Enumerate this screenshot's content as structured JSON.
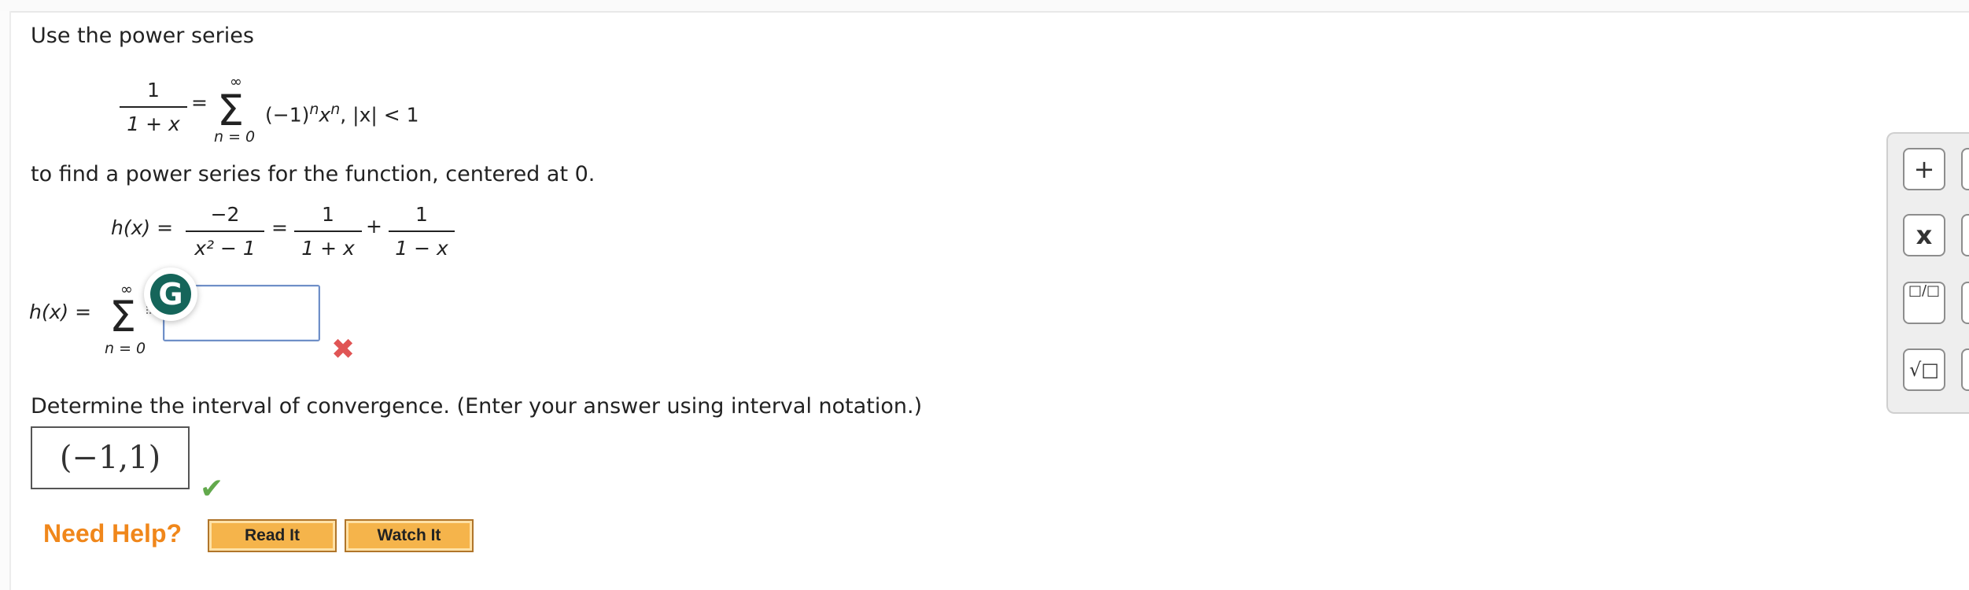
{
  "question": {
    "intro": "Use the power series",
    "given_series": {
      "frac_num": "1",
      "frac_den": "1 + x",
      "equals": "=",
      "sum_upper": "∞",
      "sum_lower": "n = 0",
      "term": "(−1)",
      "term_exp": "n",
      "term_x": "x",
      "term_x_exp": "n",
      "condition": ", |x| < 1"
    },
    "instruction": "to find a power series for the function, centered at 0.",
    "function": {
      "lhs": "h(x) =",
      "num1": "−2",
      "den1": "x² − 1",
      "equals": "=",
      "num2": "1",
      "den2": "1 + x",
      "plus": "+",
      "num3": "1",
      "den3": "1 − x"
    },
    "answer_series": {
      "lhs": "h(x) =",
      "sum_upper": "∞",
      "sum_lower": "n = 0",
      "input_value": ""
    },
    "feedback_incorrect_icon": "x-mark-icon",
    "interval_prompt": "Determine the interval of convergence. (Enter your answer using interval notation.)",
    "interval_answer": "(−1,1)",
    "feedback_correct_icon": "check-icon"
  },
  "help": {
    "label": "Need Help?",
    "read_it": "Read It",
    "watch_it": "Watch It"
  },
  "grammarly": {
    "icon": "grammarly-g-icon",
    "letter": "G"
  },
  "palette": {
    "buttons": [
      "+",
      "x",
      "□/□",
      "√□"
    ]
  },
  "colors": {
    "help_orange": "#f0871b",
    "button_fill": "#f5b44b",
    "incorrect_red": "#e05555",
    "correct_green": "#62a94c",
    "input_border": "#6f8fc7",
    "grammarly_green": "#15655a"
  }
}
